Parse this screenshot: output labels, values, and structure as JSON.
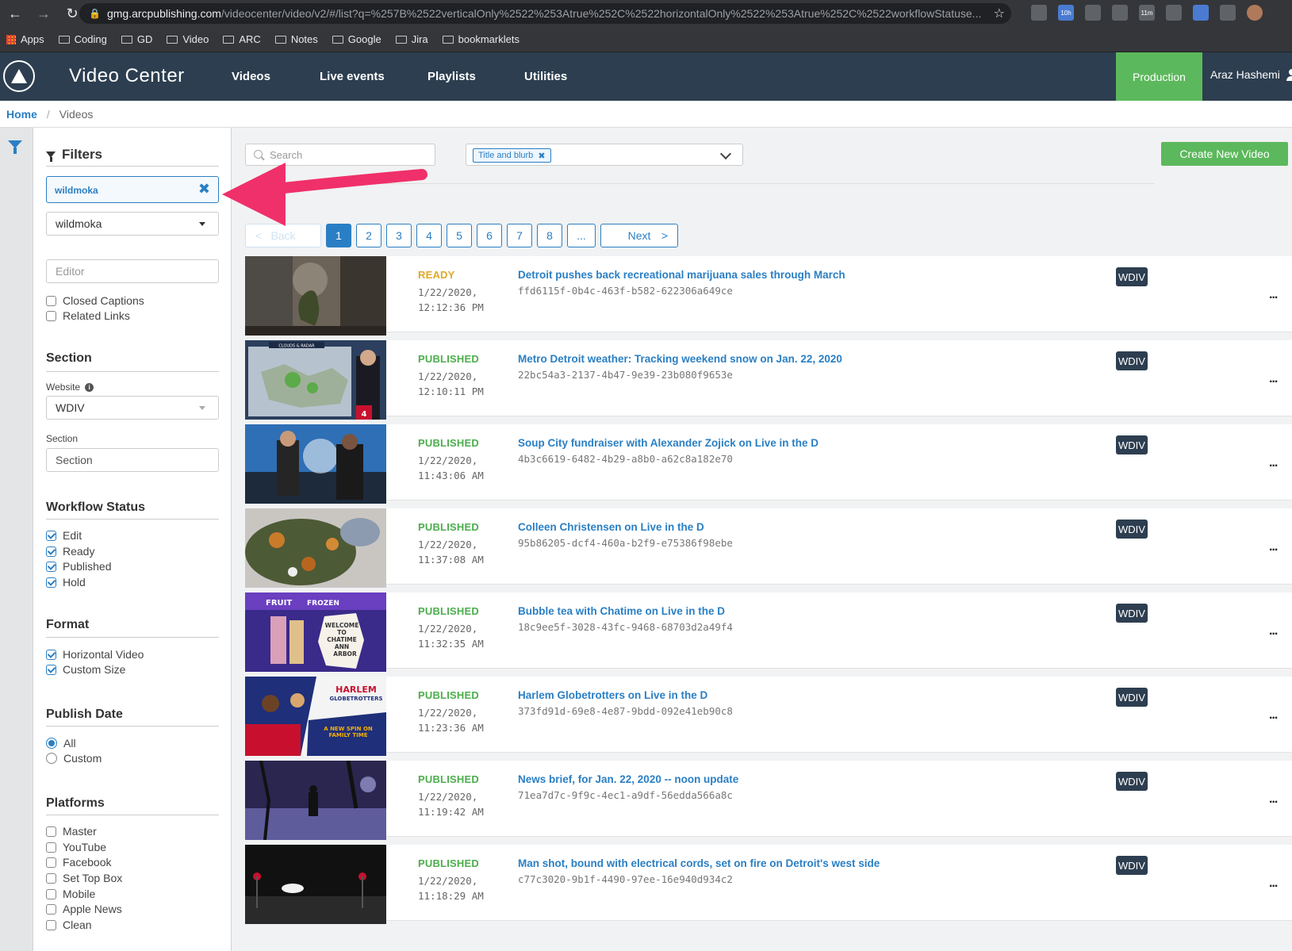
{
  "browser": {
    "url_host": "gmg.arcpublishing.com",
    "url_path": "/videocenter/video/v2/#/list?q=%257B%2522verticalOnly%2522%253Atrue%252C%2522horizontalOnly%2522%253Atrue%252C%2522workflowStatuse...",
    "ext_labels": [
      "10h",
      "11m"
    ],
    "bookmarks": [
      "Apps",
      "Coding",
      "GD",
      "Video",
      "ARC",
      "Notes",
      "Google",
      "Jira",
      "bookmarklets"
    ]
  },
  "header": {
    "app_title": "Video Center",
    "nav": [
      "Videos",
      "Live events",
      "Playlists",
      "Utilities"
    ],
    "environment": "Production",
    "user_name": "Araz Hashemi"
  },
  "breadcrumb": {
    "home": "Home",
    "separator": "/",
    "current": "Videos"
  },
  "filters": {
    "title": "Filters",
    "tag_filter": "wildmoka",
    "source_select": "wildmoka",
    "editor_placeholder": "Editor",
    "extras": [
      "Closed Captions",
      "Related Links"
    ],
    "section": {
      "title": "Section",
      "website_label": "Website",
      "website_value": "WDIV",
      "section_label": "Section",
      "section_placeholder": "Section"
    },
    "workflow": {
      "title": "Workflow Status",
      "items": [
        "Edit",
        "Ready",
        "Published",
        "Hold"
      ]
    },
    "format": {
      "title": "Format",
      "items": [
        "Horizontal Video",
        "Custom Size"
      ]
    },
    "publish_date": {
      "title": "Publish Date",
      "items": [
        "All",
        "Custom"
      ]
    },
    "platforms": {
      "title": "Platforms",
      "items": [
        "Master",
        "YouTube",
        "Facebook",
        "Set Top Box",
        "Mobile",
        "Apple News",
        "Clean"
      ]
    }
  },
  "toolbar": {
    "search_placeholder": "Search",
    "field_chip": "Title and blurb",
    "create_button": "Create New Video"
  },
  "pager": {
    "back": "Back",
    "pages": [
      "1",
      "2",
      "3",
      "4",
      "5",
      "6",
      "7",
      "8",
      "..."
    ],
    "next": "Next",
    "lt": "<",
    "gt": ">"
  },
  "videos": [
    {
      "status": "READY",
      "date": "1/22/2020,",
      "time": "12:12:36 PM",
      "title": "Detroit pushes back recreational marijuana sales through March",
      "id": "ffd6115f-0b4c-463f-b582-622306a649ce",
      "site": "WDIV"
    },
    {
      "status": "PUBLISHED",
      "date": "1/22/2020,",
      "time": "12:10:11 PM",
      "title": "Metro Detroit weather: Tracking weekend snow on Jan. 22, 2020",
      "id": "22bc54a3-2137-4b47-9e39-23b080f9653e",
      "site": "WDIV"
    },
    {
      "status": "PUBLISHED",
      "date": "1/22/2020,",
      "time": "11:43:06 AM",
      "title": "Soup City fundraiser with Alexander Zojick on Live in the D",
      "id": "4b3c6619-6482-4b29-a8b0-a62c8a182e70",
      "site": "WDIV"
    },
    {
      "status": "PUBLISHED",
      "date": "1/22/2020,",
      "time": "11:37:08 AM",
      "title": "Colleen Christensen on Live in the D",
      "id": "95b86205-dcf4-460a-b2f9-e75386f98ebe",
      "site": "WDIV"
    },
    {
      "status": "PUBLISHED",
      "date": "1/22/2020,",
      "time": "11:32:35 AM",
      "title": "Bubble tea with Chatime on Live in the D",
      "id": "18c9ee5f-3028-43fc-9468-68703d2a49f4",
      "site": "WDIV"
    },
    {
      "status": "PUBLISHED",
      "date": "1/22/2020,",
      "time": "11:23:36 AM",
      "title": "Harlem Globetrotters on Live in the D",
      "id": "373fd91d-69e8-4e87-9bdd-092e41eb90c8",
      "site": "WDIV"
    },
    {
      "status": "PUBLISHED",
      "date": "1/22/2020,",
      "time": "11:19:42 AM",
      "title": "News brief, for Jan. 22, 2020 -- noon update",
      "id": "71ea7d7c-9f9c-4ec1-a9df-56edda566a8c",
      "site": "WDIV"
    },
    {
      "status": "PUBLISHED",
      "date": "1/22/2020,",
      "time": "11:18:29 AM",
      "title": "Man shot, bound with electrical cords, set on fire on Detroit's west side",
      "id": "c77c3020-9b1f-4490-97ee-16e940d934c2",
      "site": "WDIV"
    }
  ],
  "thumb_text": {
    "weather_banner": "CLOUDS & RADAR",
    "channel_num": "4",
    "tea_sign": [
      "WELCOME",
      "TO",
      "CHATIME",
      "ANN",
      "ARBOR"
    ],
    "tea_fruit": "FRUIT",
    "tea_frozen": "FROZEN",
    "harlem_line1": "HARLEM",
    "harlem_line2": "GLOBETROTTERS",
    "harlem_tag1": "A NEW SPIN ON",
    "harlem_tag2": "FAMILY TIME"
  },
  "more_glyph": "...",
  "remove_glyph": "✖",
  "info_glyph": "i",
  "colors": {
    "header_bg": "#2d3e50",
    "accent_blue": "#2a7fc4",
    "green": "#5cb85c",
    "ready": "#e0a828",
    "annotation_arrow": "#f0306a"
  }
}
